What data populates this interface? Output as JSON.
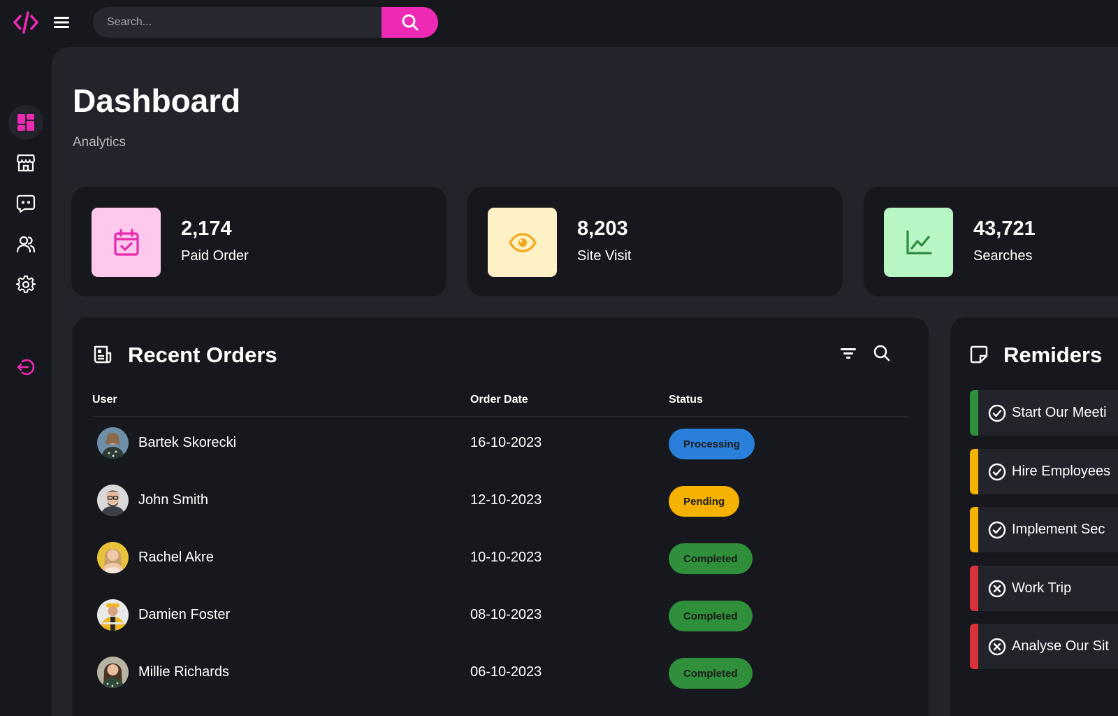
{
  "header": {
    "search_placeholder": "Search..."
  },
  "sidebar": {
    "items": [
      {
        "icon": "dashboard-icon",
        "active": true
      },
      {
        "icon": "store-icon",
        "active": false
      },
      {
        "icon": "chat-icon",
        "active": false
      },
      {
        "icon": "users-icon",
        "active": false
      },
      {
        "icon": "gear-icon",
        "active": false
      },
      {
        "icon": "logout-icon",
        "active": false
      }
    ]
  },
  "page": {
    "title": "Dashboard",
    "subtitle": "Analytics"
  },
  "stats": [
    {
      "value": "2,174",
      "label": "Paid Order",
      "icon": "calendar-check-icon",
      "bg": "#ffc9ee",
      "fg": "#e62aae"
    },
    {
      "value": "8,203",
      "label": "Site Visit",
      "icon": "eye-icon",
      "bg": "#fff1c6",
      "fg": "#f2a81a"
    },
    {
      "value": "43,721",
      "label": "Searches",
      "icon": "chart-line-icon",
      "bg": "#b9f6c5",
      "fg": "#2e8b3d"
    }
  ],
  "orders": {
    "title": "Recent Orders",
    "columns": {
      "user": "User",
      "date": "Order Date",
      "status": "Status"
    },
    "rows": [
      {
        "user": "Bartek Skorecki",
        "date": "16-10-2023",
        "status": "Processing",
        "status_color": "#2a7fdb"
      },
      {
        "user": "John Smith",
        "date": "12-10-2023",
        "status": "Pending",
        "status_color": "#f6b200"
      },
      {
        "user": "Rachel Akre",
        "date": "10-10-2023",
        "status": "Completed",
        "status_color": "#2f8f3a"
      },
      {
        "user": "Damien Foster",
        "date": "08-10-2023",
        "status": "Completed",
        "status_color": "#2f8f3a"
      },
      {
        "user": "Millie Richards",
        "date": "06-10-2023",
        "status": "Completed",
        "status_color": "#2f8f3a"
      }
    ]
  },
  "reminders": {
    "title": "Remiders",
    "items": [
      {
        "text": "Start Our Meeti",
        "state": "check",
        "color": "#2f8f3a"
      },
      {
        "text": "Hire Employees",
        "state": "check",
        "color": "#f6b200"
      },
      {
        "text": "Implement Sec",
        "state": "check",
        "color": "#f6b200"
      },
      {
        "text": "Work Trip",
        "state": "x",
        "color": "#d8333a"
      },
      {
        "text": "Analyse Our Sit",
        "state": "x",
        "color": "#d8333a"
      }
    ]
  },
  "colors": {
    "accent": "#ee2ab5",
    "background": "#17181d",
    "panel": "#22232b"
  }
}
